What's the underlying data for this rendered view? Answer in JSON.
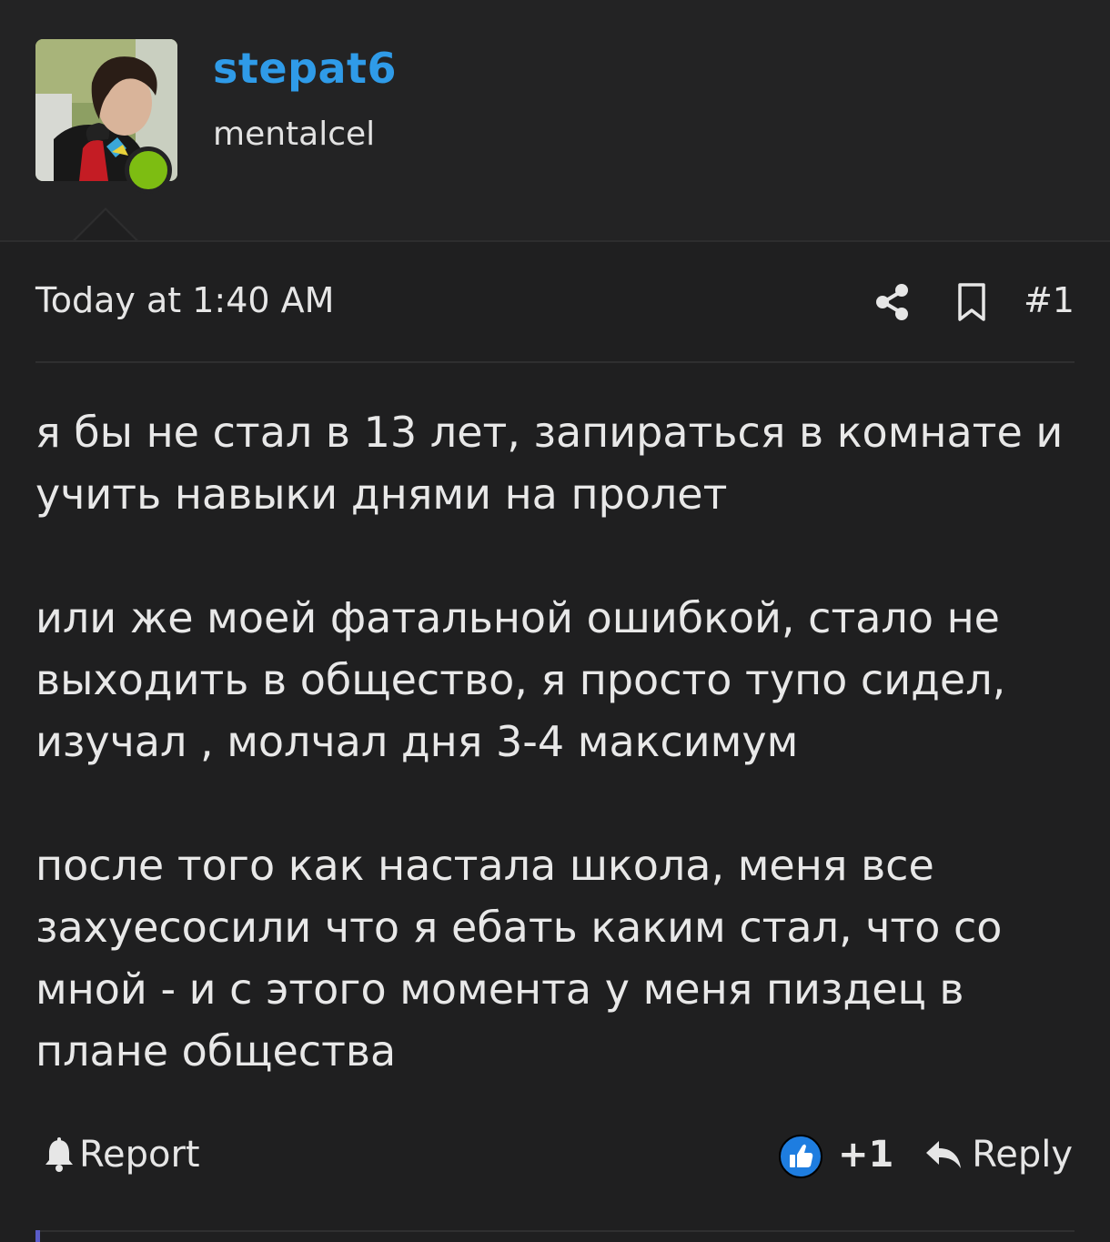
{
  "user": {
    "username": "stepat6",
    "title": "mentalcel",
    "status": "online"
  },
  "post": {
    "timestamp": "Today at 1:40 AM",
    "number": "#1",
    "paragraphs": [
      "я бы не стал в 13 лет, запираться в комнате и учить навыки днями на пролет",
      "или же моей фатальной ошибкой, стало не выходить в общество, я просто тупо сидел, изучал , молчал дня 3-4 максимум",
      "после того как настала школа, меня все захуесосили что я ебать каким стал, что со мной - и с этого момента у меня пиздец в плане общества"
    ]
  },
  "footer": {
    "report_label": "Report",
    "reaction_count": "+1",
    "reply_label": "Reply"
  },
  "icons": {
    "share": "share-icon",
    "bookmark": "bookmark-icon",
    "report": "bell-icon",
    "reaction": "thumbs-up-icon",
    "reply": "reply-arrow-icon"
  },
  "colors": {
    "background": "#1f1f20",
    "header_background": "#232324",
    "username": "#2f9be8",
    "online": "#7dbd12",
    "reaction": "#1e7de0",
    "text": "#e8e8e8"
  }
}
